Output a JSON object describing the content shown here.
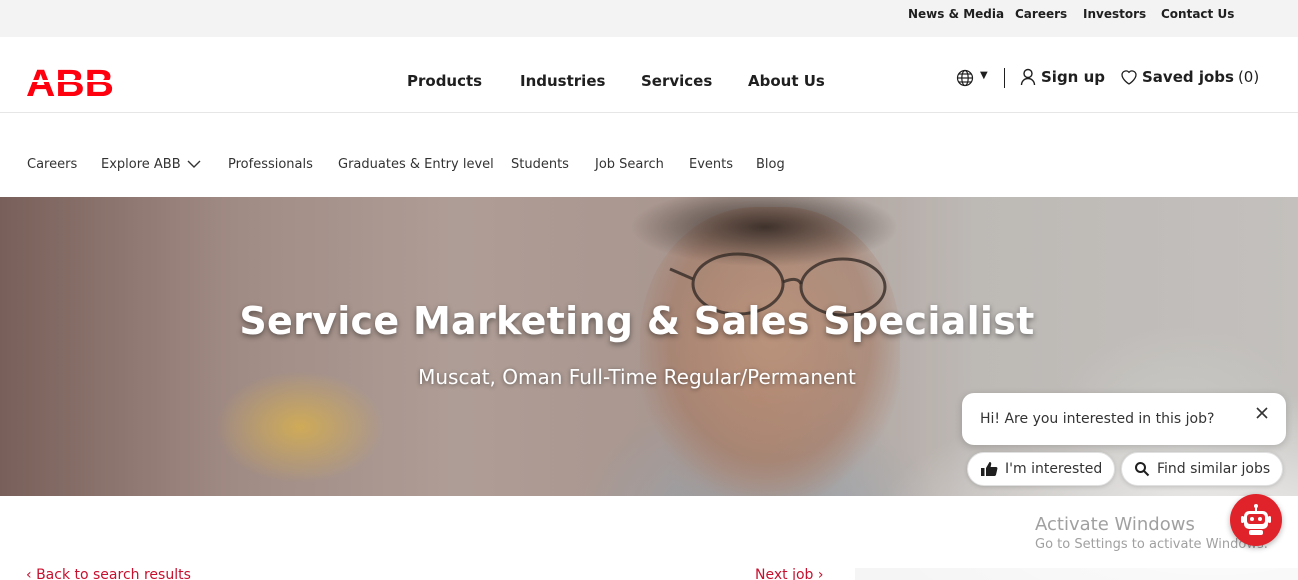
{
  "brand": {
    "logo_text": "ABB",
    "accent_color": "#ff000f"
  },
  "utility_nav": [
    "News & Media",
    "Careers",
    "Investors",
    "Contact Us"
  ],
  "main_nav": [
    "Products",
    "Industries",
    "Services",
    "About Us"
  ],
  "header_actions": {
    "language_icon": "globe-icon",
    "sign_up": "Sign up",
    "saved_jobs_label": "Saved jobs",
    "saved_jobs_count": "(0)"
  },
  "careers_nav": [
    "Careers",
    "Explore ABB",
    "Professionals",
    "Graduates & Entry level",
    "Students",
    "Job Search",
    "Events",
    "Blog"
  ],
  "hero": {
    "title": "Service Marketing & Sales Specialist",
    "meta": "Muscat, Oman Full-Time Regular/Permanent"
  },
  "pagination": {
    "back": "Back to search results",
    "next": "Next job"
  },
  "chat": {
    "message": "Hi! Are you interested in this job?",
    "interested": "I'm interested",
    "find_similar": "Find similar jobs",
    "bot_color": "#e0232a"
  },
  "watermark": {
    "line1": "Activate Windows",
    "line2": "Go to Settings to activate Windows."
  }
}
